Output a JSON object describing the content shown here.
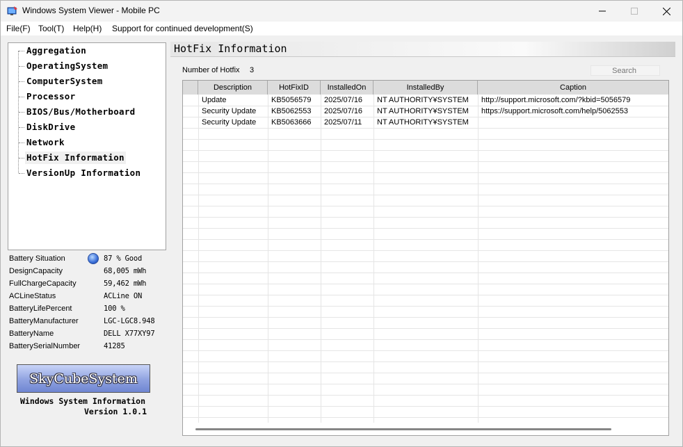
{
  "window": {
    "title": "Windows System Viewer - Mobile PC"
  },
  "menu": [
    "File(F)",
    "Tool(T)",
    "Help(H)",
    "Support for continued development(S)"
  ],
  "tree": {
    "items": [
      "Aggregation",
      "OperatingSystem",
      "ComputerSystem",
      "Processor",
      "BIOS/Bus/Motherboard",
      "DiskDrive",
      "Network",
      "HotFix Information",
      "VersionUp Information"
    ],
    "selected": "HotFix Information"
  },
  "battery": {
    "rows": [
      {
        "label": "Battery Situation",
        "value": "87 % Good"
      },
      {
        "label": "DesignCapacity",
        "value": "68,005 mWh"
      },
      {
        "label": "FullChargeCapacity",
        "value": "59,462 mWh"
      },
      {
        "label": "ACLineStatus",
        "value": "ACLine ON"
      },
      {
        "label": "BatteryLifePercent",
        "value": "100 %"
      },
      {
        "label": "BatteryManufacturer",
        "value": "LGC-LGC8.948"
      },
      {
        "label": "BatteryName",
        "value": "DELL X77XY97"
      },
      {
        "label": "BatterySerialNumber",
        "value": "41285"
      }
    ],
    "icon": "battery-status-orb-icon"
  },
  "branding": {
    "logo_text": "SkyCubeSystem",
    "app_name": "Windows System Information",
    "version": "Version 1.0.1"
  },
  "panel": {
    "title": "HotFix Information",
    "count_label": "Number of Hotfix",
    "count": "3",
    "search_placeholder": "Search"
  },
  "table": {
    "columns": [
      "Description",
      "HotFixID",
      "InstalledOn",
      "InstalledBy",
      "Caption"
    ],
    "rows": [
      [
        "Update",
        "KB5056579",
        "2025/07/16",
        "NT AUTHORITY¥SYSTEM",
        "http://support.microsoft.com/?kbid=5056579"
      ],
      [
        "Security Update",
        "KB5062553",
        "2025/07/16",
        "NT AUTHORITY¥SYSTEM",
        "https://support.microsoft.com/help/5062553"
      ],
      [
        "Security Update",
        "KB5063666",
        "2025/07/11",
        "NT AUTHORITY¥SYSTEM",
        ""
      ]
    ]
  },
  "colors": {
    "logo_gradient_top": "#c8d4f8",
    "logo_gradient_bottom": "#6f86d2",
    "header_bg": "#dcdcdc"
  }
}
